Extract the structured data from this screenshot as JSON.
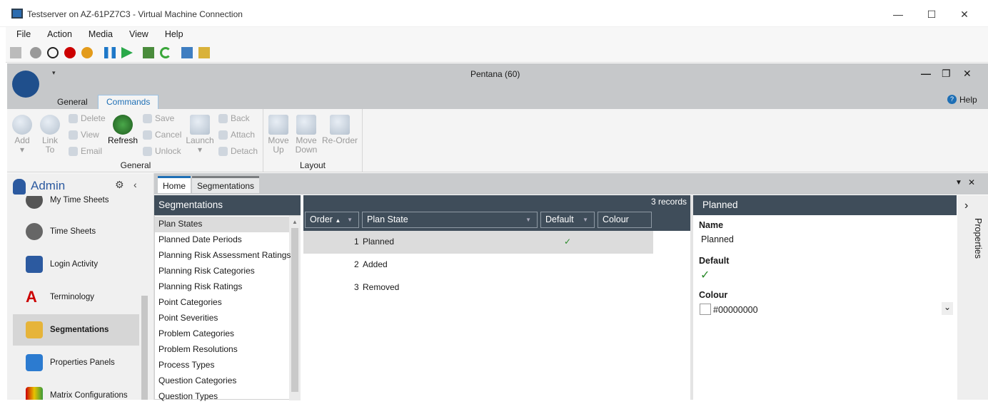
{
  "window": {
    "title": "Testserver on AZ-61PZ7C3 - Virtual Machine Connection",
    "minimize": "—",
    "maximize": "☐",
    "close": "✕"
  },
  "menu": [
    "File",
    "Action",
    "Media",
    "View",
    "Help"
  ],
  "app": {
    "title": "Pentana (60)",
    "tabs": [
      "General",
      "Commands"
    ],
    "help": "Help",
    "controls": {
      "minimize": "—",
      "restore": "❐",
      "close": "✕"
    }
  },
  "ribbon": {
    "add": "Add",
    "link": "Link",
    "link2": "To",
    "refresh": "Refresh",
    "launch": "Launch",
    "move_up": "Move",
    "move_up2": "Up",
    "move_down": "Move",
    "move_down2": "Down",
    "reorder": "Re-Order",
    "delete": "Delete",
    "view": "View",
    "email": "Email",
    "save": "Save",
    "cancel": "Cancel",
    "unlock": "Unlock",
    "back": "Back",
    "attach": "Attach",
    "detach": "Detach",
    "group_general": "General",
    "group_layout": "Layout"
  },
  "nav": {
    "title": "Admin",
    "items": [
      "My Time Sheets",
      "Time Sheets",
      "Login Activity",
      "Terminology",
      "Segmentations",
      "Properties Panels",
      "Matrix Configurations"
    ]
  },
  "doc_tabs": [
    "Home",
    "Segmentations"
  ],
  "segpanel": {
    "title": "Segmentations",
    "items": [
      "Plan States",
      "Planned Date Periods",
      "Planning Risk Assessment Ratings",
      "Planning Risk Categories",
      "Planning Risk Ratings",
      "Point Categories",
      "Point Severities",
      "Problem Categories",
      "Problem Resolutions",
      "Process Types",
      "Question Categories",
      "Question Types"
    ]
  },
  "grid": {
    "records": "3 records",
    "cols": [
      "Order",
      "Plan State",
      "Default",
      "Colour"
    ],
    "sort_asc": "▲",
    "filter": "▼",
    "rows": [
      {
        "order": "1",
        "state": "Planned",
        "default": "✓"
      },
      {
        "order": "2",
        "state": "Added",
        "default": ""
      },
      {
        "order": "3",
        "state": "Removed",
        "default": ""
      }
    ]
  },
  "props": {
    "title": "Planned",
    "name_label": "Name",
    "name_value": "Planned",
    "default_label": "Default",
    "default_value": "✓",
    "colour_label": "Colour",
    "colour_value": "#00000000",
    "side": "Properties",
    "expand": "›",
    "dropdown": "⌄"
  },
  "colors": {
    "header": "#3f4d5a",
    "accent": "#1e6fb5"
  }
}
